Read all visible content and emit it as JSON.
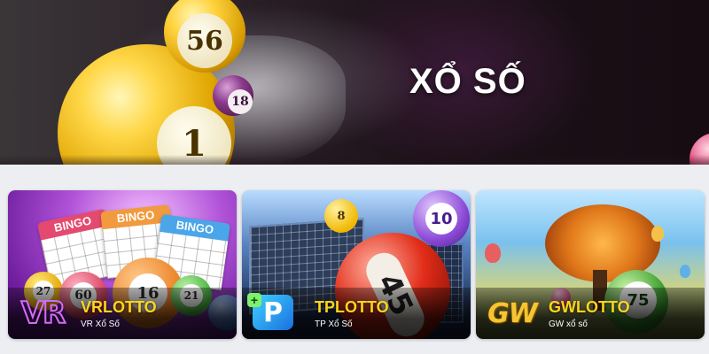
{
  "banner": {
    "title": "XỔ SỐ",
    "balls": {
      "big": "1",
      "yellow": "56",
      "purple": "18"
    }
  },
  "games": [
    {
      "name": "VRLOTTO",
      "subtitle": "VR Xổ Số",
      "logo_text": "VR",
      "art_numbers": [
        "27",
        "60",
        "16",
        "21"
      ],
      "art_labels": [
        "BINGO",
        "BINGO",
        "BINGO"
      ]
    },
    {
      "name": "TPLOTTO",
      "subtitle": "TP Xổ Số",
      "logo_text": "P",
      "logo_plus": "+",
      "art_numbers": [
        "8",
        "45",
        "10"
      ]
    },
    {
      "name": "GWLOTTO",
      "subtitle": "GW xổ số",
      "logo_text": "GW",
      "art_numbers": [
        "75"
      ]
    }
  ],
  "colors": {
    "accent_yellow": "#ffd51a",
    "page_bg": "#eceef1",
    "vr_logo": "#d56bf5",
    "gw_logo": "#f6c531"
  },
  "icons": {
    "vr_logo": "vrlotto-logo-icon",
    "tp_logo": "tplotto-logo-icon",
    "gw_logo": "gwlotto-logo-icon"
  }
}
